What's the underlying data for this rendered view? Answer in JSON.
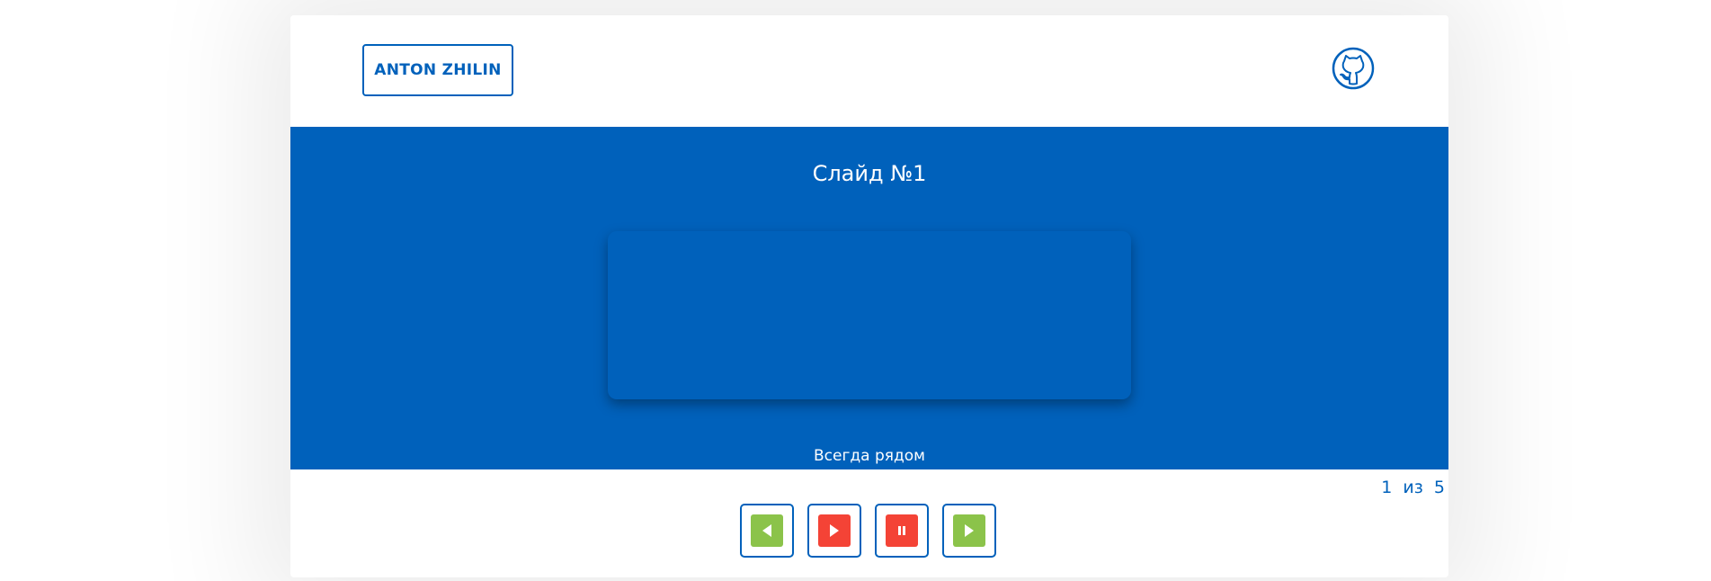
{
  "header": {
    "logo_label": "ANTON ZHILIN",
    "github_icon": "github-octocat-icon"
  },
  "slider": {
    "title": "Слайд №1",
    "caption": "Всегда рядом",
    "counter": {
      "current": "1",
      "separator": "из",
      "total": "5"
    }
  },
  "controls": [
    {
      "name": "prev-button",
      "icon": "triangle-left-icon",
      "color": "#8bc34a"
    },
    {
      "name": "play-button",
      "icon": "triangle-right-icon",
      "color": "#f44336"
    },
    {
      "name": "pause-button",
      "icon": "pause-icon",
      "color": "#f44336"
    },
    {
      "name": "next-button",
      "icon": "triangle-right-icon",
      "color": "#8bc34a"
    }
  ],
  "colors": {
    "brand": "#0061bb",
    "green": "#8bc34a",
    "red": "#f44336"
  }
}
